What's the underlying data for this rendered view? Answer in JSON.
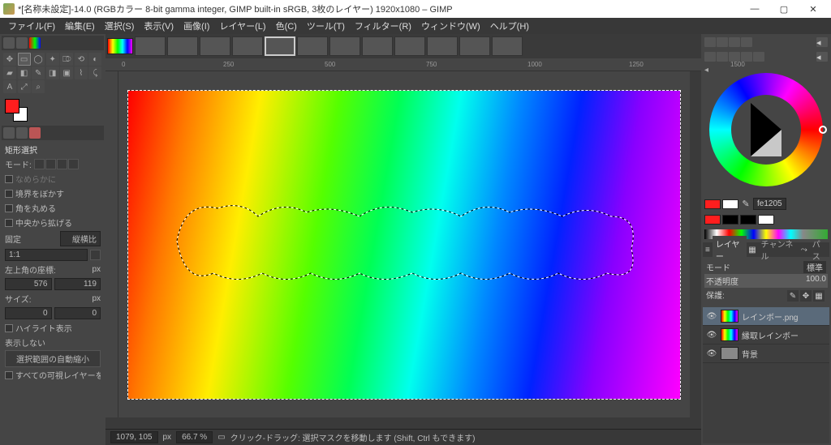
{
  "title": "*[名称未設定]-14.0 (RGBカラー 8-bit gamma integer, GIMP built-in sRGB, 3枚のレイヤー) 1920x1080 – GIMP",
  "menu": [
    "ファイル(F)",
    "編集(E)",
    "選択(S)",
    "表示(V)",
    "画像(I)",
    "レイヤー(L)",
    "色(C)",
    "ツール(T)",
    "フィルター(R)",
    "ウィンドウ(W)",
    "ヘルプ(H)"
  ],
  "ruler_marks": [
    {
      "p": 20,
      "l": "0"
    },
    {
      "p": 145,
      "l": "250"
    },
    {
      "p": 270,
      "l": "500"
    },
    {
      "p": 395,
      "l": "750"
    },
    {
      "p": 520,
      "l": "1000"
    },
    {
      "p": 645,
      "l": "1250"
    },
    {
      "p": 770,
      "l": "1500"
    }
  ],
  "tool_options": {
    "title": "矩形選択",
    "mode_label": "モード:",
    "antialias": "なめらかに",
    "feather": "境界をぼかす",
    "round": "角を丸める",
    "expand_center": "中央から拡げる",
    "fixed": "固定",
    "fixed_mode": "縦横比",
    "ratio": "1:1",
    "pos_label": "左上角の座標:",
    "pos_unit": "px",
    "pos_x": "576",
    "pos_y": "119",
    "size_label": "サイズ:",
    "size_unit": "px",
    "size_w": "0",
    "size_h": "0",
    "highlight": "ハイライト表示",
    "noshow": "表示しない",
    "autoshrink": "選択範囲の自動縮小",
    "alllayers": "すべての可視レイヤーを対象にす"
  },
  "right": {
    "hex": "fe1205",
    "panel_tabs": [
      "レイヤー",
      "チャンネル",
      "パス"
    ],
    "mode_label": "モード",
    "mode_value": "標準",
    "opacity_label": "不透明度",
    "opacity_value": "100.0",
    "lock_label": "保護:",
    "layers": [
      {
        "name": "レインボー.png",
        "sel": true,
        "thumb": "rainbow"
      },
      {
        "name": "縁取レインボー",
        "sel": false,
        "thumb": "rainbow"
      },
      {
        "name": "背景",
        "sel": false,
        "thumb": "plain"
      }
    ]
  },
  "status": {
    "coords": "1079, 105",
    "unit": "px",
    "zoom": "66.7 %",
    "hint": "クリック-ドラッグ: 選択マスクを移動します (Shift, Ctrl もできます)"
  }
}
